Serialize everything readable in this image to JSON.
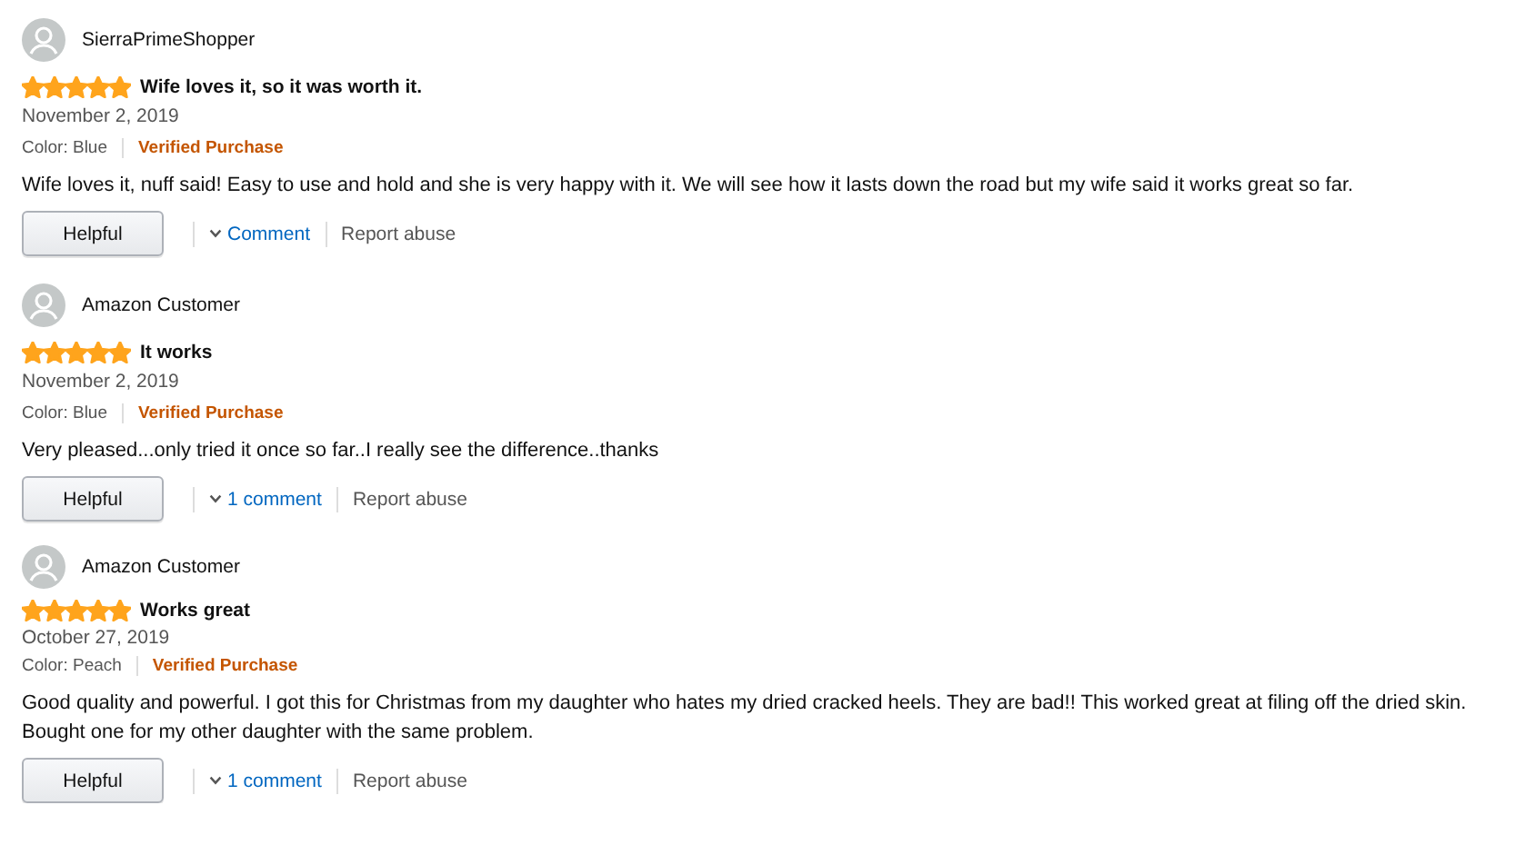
{
  "reviews": [
    {
      "author": "SierraPrimeShopper",
      "stars": 5,
      "title": "Wife loves it, so it was worth it.",
      "date": "November 2, 2019",
      "variant": "Color: Blue",
      "verified": "Verified Purchase",
      "body": "Wife loves it, nuff said! Easy to use and hold and she is very happy with it. We will see how it lasts down the road but my wife said it works great so far.",
      "helpful": "Helpful",
      "comment": "Comment",
      "report": "Report abuse"
    },
    {
      "author": "Amazon Customer",
      "stars": 5,
      "title": "It works",
      "date": "November 2, 2019",
      "variant": "Color: Blue",
      "verified": "Verified Purchase",
      "body": "Very pleased...only tried it once so far..I really see the difference..thanks",
      "helpful": "Helpful",
      "comment": "1 comment",
      "report": "Report abuse"
    },
    {
      "author": "Amazon Customer",
      "stars": 5,
      "title": "Works great",
      "date": "October 27, 2019",
      "variant": "Color: Peach",
      "verified": "Verified Purchase",
      "body": "Good quality and powerful. I got this for Christmas from my daughter who hates my dried cracked heels. They are bad!! This worked great at filing off the dried skin. Bought one for my other daughter with the same problem.",
      "helpful": "Helpful",
      "comment": "1 comment",
      "report": "Report abuse"
    }
  ]
}
